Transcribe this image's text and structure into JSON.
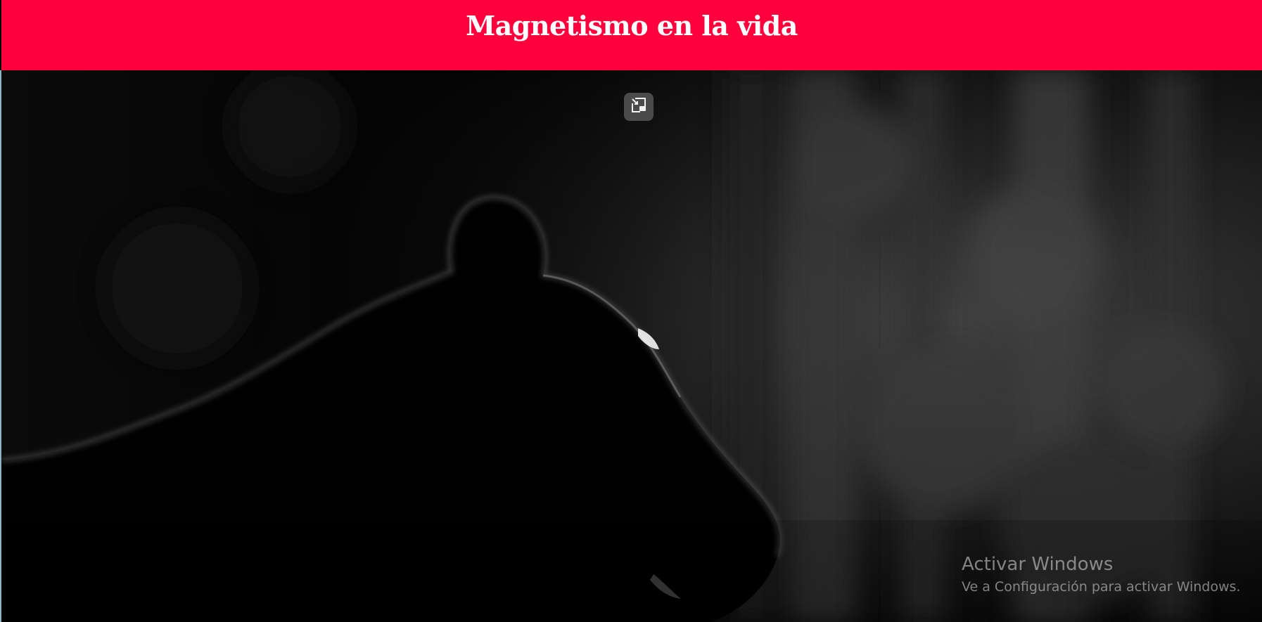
{
  "header": {
    "title": "Magnetismo en la vida",
    "background": "#ff003c",
    "text_color": "#ffffff"
  },
  "video": {
    "icon": "picture-in-picture-icon"
  },
  "watermark": {
    "title": "Activar Windows",
    "text": "Ve a Configuración para activar Windows."
  }
}
